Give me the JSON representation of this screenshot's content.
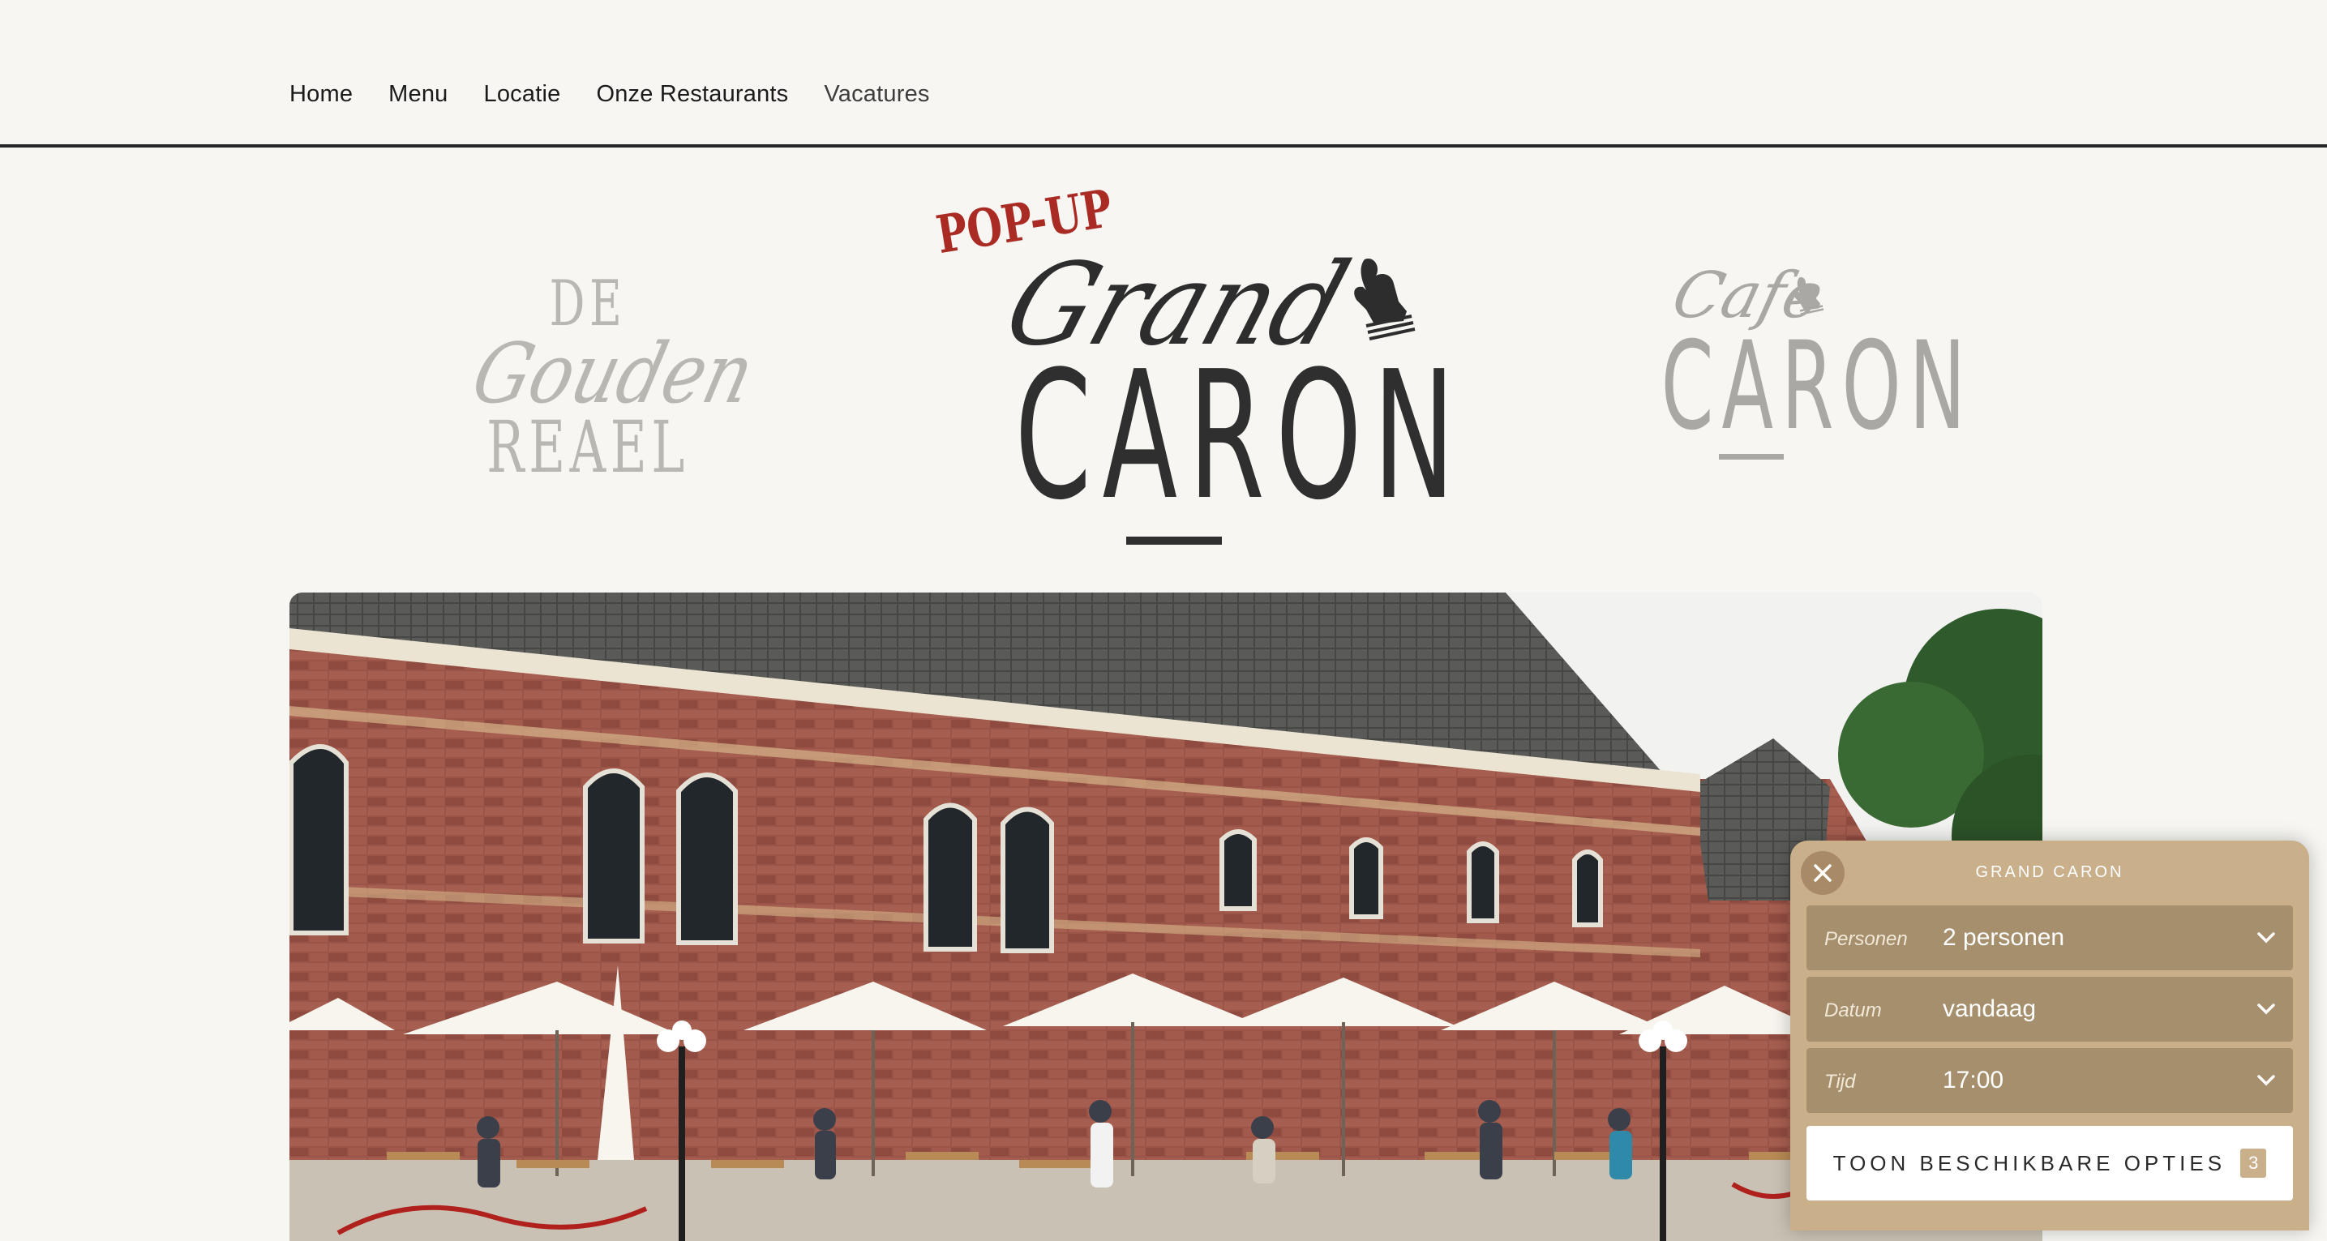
{
  "nav": {
    "items": [
      {
        "label": "Home"
      },
      {
        "label": "Menu"
      },
      {
        "label": "Locatie"
      },
      {
        "label": "Onze Restaurants"
      },
      {
        "label": "Vacatures"
      }
    ]
  },
  "logos": {
    "gouden_reael": {
      "line1": "DE",
      "line2": "Gouden",
      "line3": "REAEL"
    },
    "grand_caron": {
      "tag": "POP-UP",
      "script": "Grand",
      "name": "CARON"
    },
    "cafe_caron": {
      "script": "Cafe",
      "name": "CARON"
    }
  },
  "hero": {
    "icon": "restaurant-terrace-photo"
  },
  "booking": {
    "title": "GRAND CARON",
    "fields": [
      {
        "label": "Personen",
        "value": "2 personen"
      },
      {
        "label": "Datum",
        "value": "vandaag"
      },
      {
        "label": "Tijd",
        "value": "17:00"
      }
    ],
    "submit_label": "TOON BESCHIKBARE OPTIES",
    "options_count": "3",
    "colors": {
      "panel": "#c9b08b",
      "field": "#a58f6c",
      "accent_red": "#a92b24"
    }
  }
}
